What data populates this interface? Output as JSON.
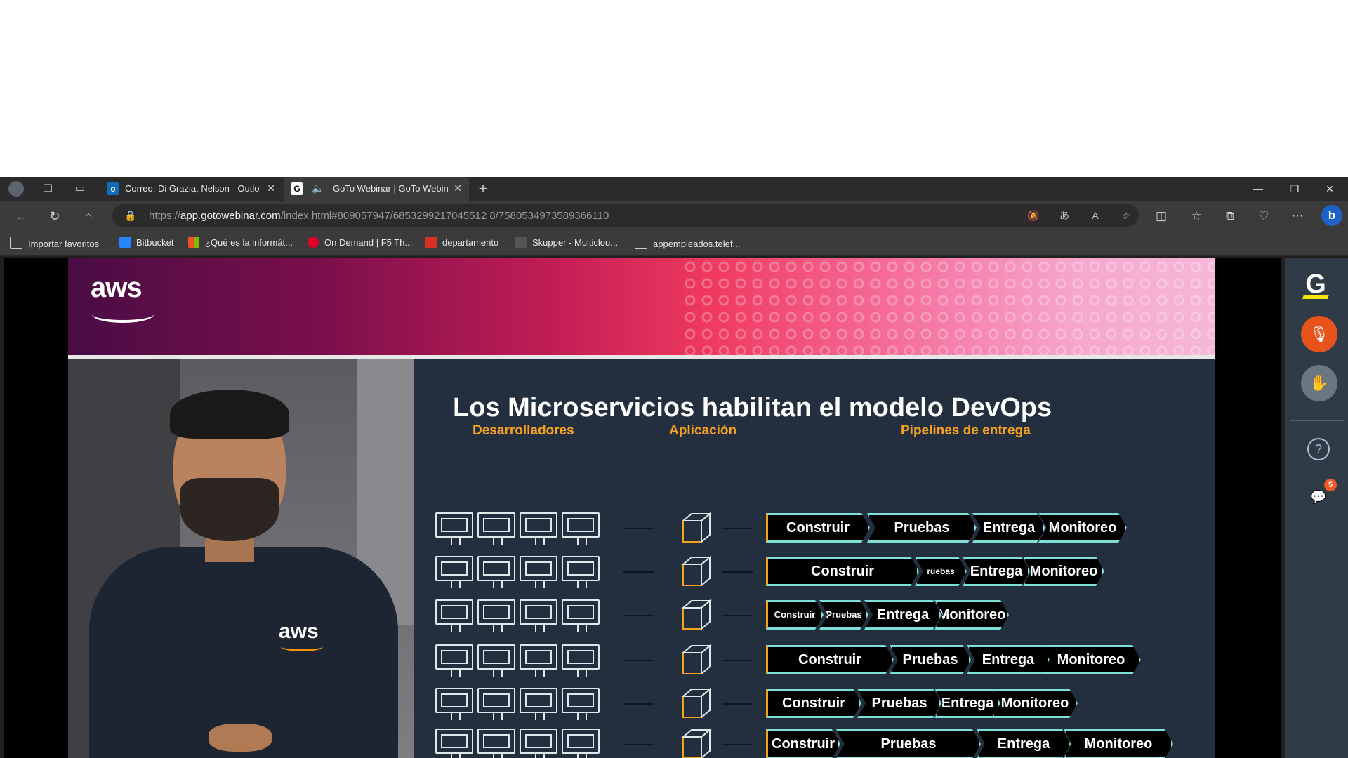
{
  "browser": {
    "tabs": [
      {
        "title": "Correo: Di Grazia, Nelson - Outlo",
        "favicon": "outlook-icon",
        "active": false
      },
      {
        "title": "GoTo Webinar | GoTo Webin",
        "favicon": "goto-icon",
        "active": true
      }
    ],
    "new_tab": "+",
    "address": {
      "scheme": "https://",
      "host": "app.gotowebinar.com",
      "path": "/index.html#809057947/6853299217045512 8/7580534973589366110"
    },
    "bookmarks": [
      "Importar favoritos",
      "Bitbucket",
      "¿Qué es la informát...",
      "On Demand | F5 Th...",
      "departamento",
      "Skupper - Multiclou...",
      "appempleados.telef..."
    ]
  },
  "slide": {
    "logo": "aws",
    "title": "Los Microservicios habilitan el modelo DevOps",
    "col_devs": "Desarrolladores",
    "col_app": "Aplicación",
    "col_pipes": "Pipelines de entrega",
    "shirt_logo": "aws",
    "rows": [
      {
        "stages": [
          "Construir",
          "Pruebas",
          "Entrega",
          "Monitoreo"
        ]
      },
      {
        "stages": [
          "Construir",
          "ruebas",
          "Entrega",
          "Monitoreo"
        ]
      },
      {
        "stages": [
          "Construir",
          "Pruebas",
          "Entrega",
          "Monitoreo"
        ]
      },
      {
        "stages": [
          "Construir",
          "Pruebas",
          "Entrega",
          "Monitoreo"
        ]
      },
      {
        "stages": [
          "Construir",
          "Pruebas",
          "Entrega",
          "Monitoreo"
        ]
      },
      {
        "stages": [
          "Construir",
          "Pruebas",
          "Entrega",
          "Monitoreo"
        ]
      }
    ]
  },
  "side_panel": {
    "logo": "G",
    "chat_badge": "5",
    "colors": {
      "mic": "#e8531b",
      "accent": "#f7e400"
    }
  },
  "colors": {
    "pipeline_border": "#7de0d8",
    "orange": "#f7a21b",
    "slide_bg": "#232f3e"
  }
}
